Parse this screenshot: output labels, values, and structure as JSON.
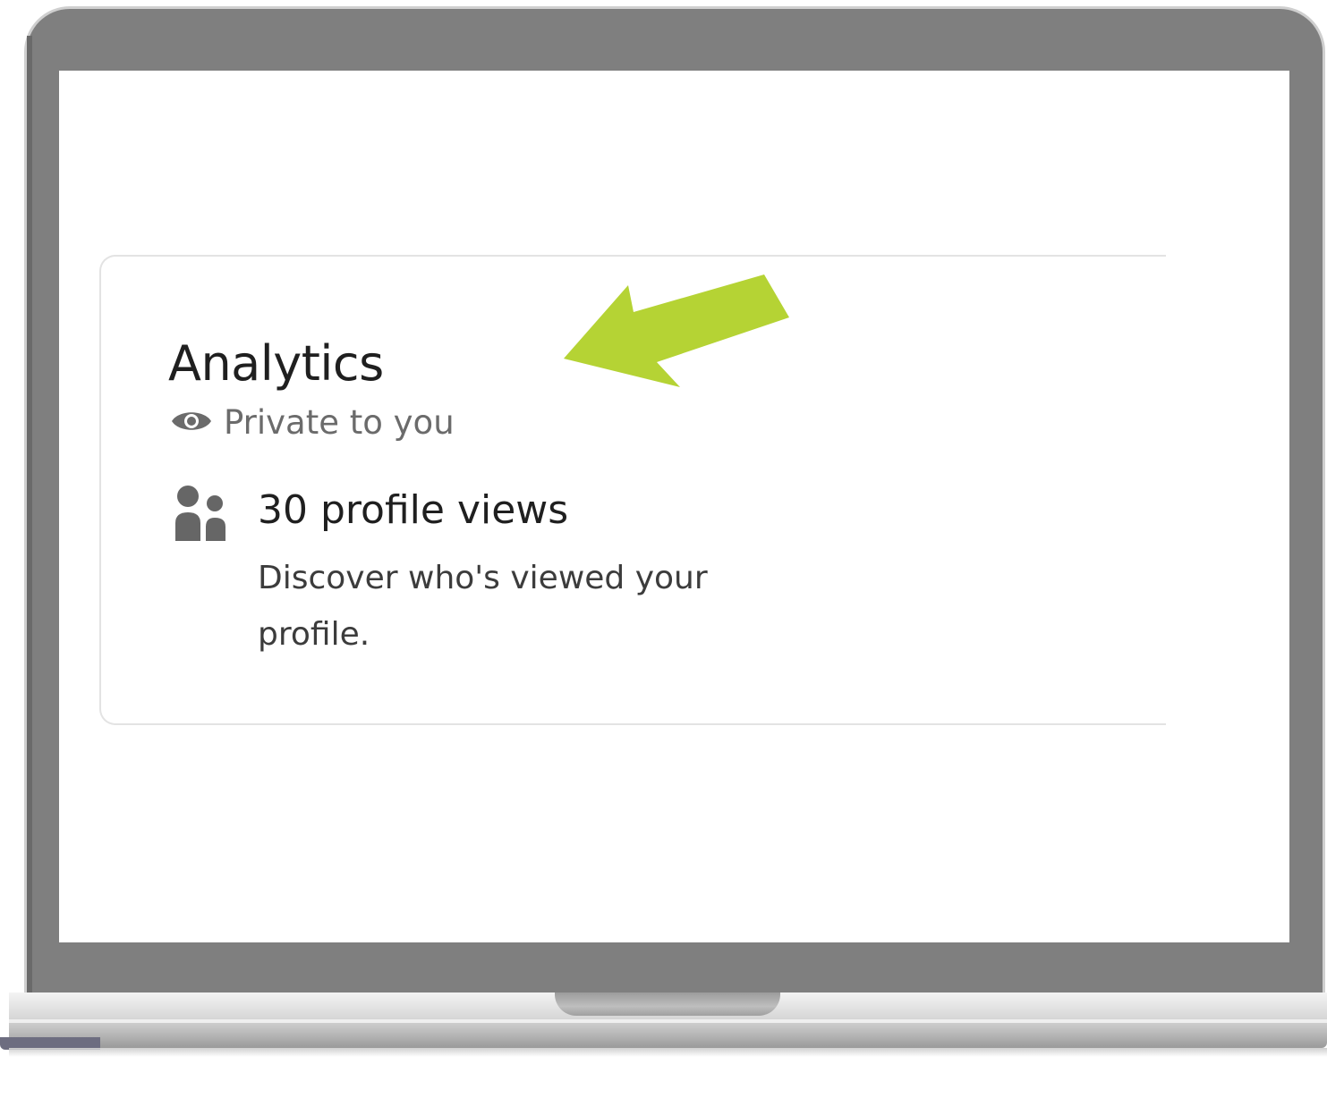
{
  "analytics_card": {
    "title": "Analytics",
    "visibility_label": "Private to you",
    "visibility_icon": "eye-icon",
    "stat": {
      "icon": "people-icon",
      "title": "30 profile views",
      "description": "Discover who's viewed your profile."
    }
  },
  "annotation": {
    "icon": "arrow-icon",
    "color": "#b5d334"
  },
  "colors": {
    "bezel": "#7f7f7f",
    "text_primary": "#1f1f1f",
    "text_secondary": "#6b6b6b",
    "card_border": "#e3e3e3"
  }
}
